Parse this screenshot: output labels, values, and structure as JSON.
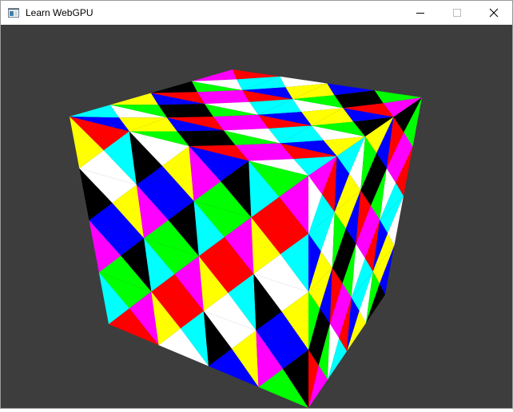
{
  "window": {
    "title": "Learn WebGPU",
    "icon": "app-window-icon",
    "controls": [
      "minimize-icon",
      "maximize-icon",
      "close-icon"
    ]
  },
  "viewport": {
    "background": "#3d3d3d",
    "scene": "rotated-cube",
    "palette": [
      "#ff0000",
      "#ffff00",
      "#00ff00",
      "#00ffff",
      "#0000ff",
      "#ff00ff",
      "#ffffff",
      "#000000"
    ]
  }
}
